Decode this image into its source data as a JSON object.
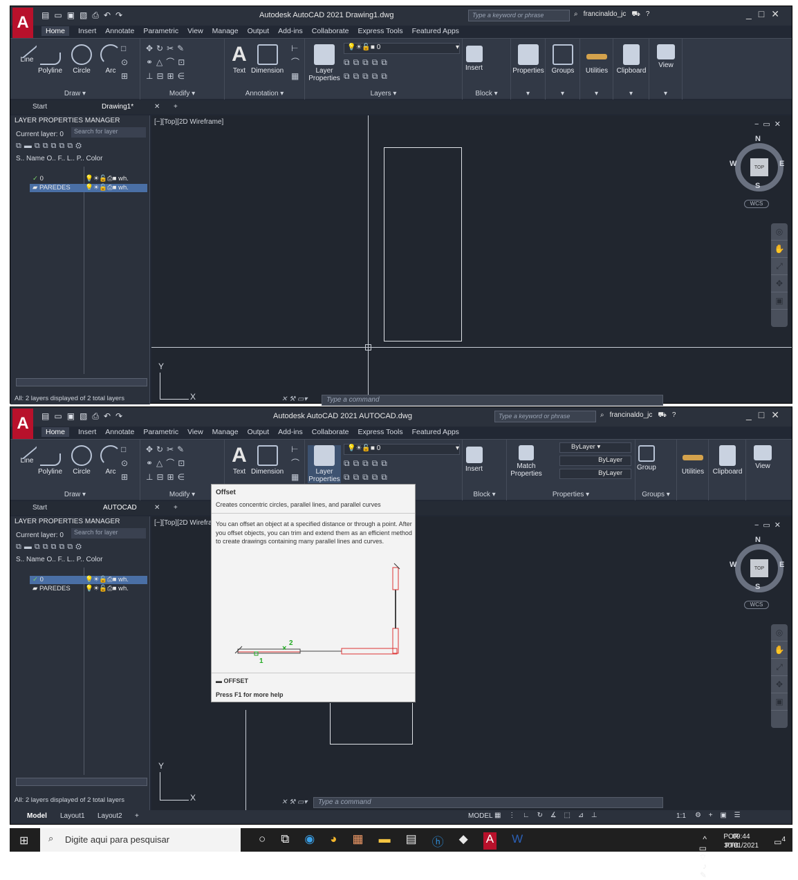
{
  "top_window": {
    "app_title": "Autodesk AutoCAD 2021  Drawing1.dwg",
    "search_placeholder": "Type a keyword or phrase",
    "user": "francinaldo_jc",
    "ribbon_tabs": [
      "Home",
      "Insert",
      "Annotate",
      "Parametric",
      "View",
      "Manage",
      "Output",
      "Add-ins",
      "Collaborate",
      "Express Tools",
      "Featured Apps"
    ],
    "draw_buttons": [
      "Line",
      "Polyline",
      "Circle",
      "Arc"
    ],
    "groups": {
      "draw": "Draw ▾",
      "modify": "Modify ▾",
      "annotation": "Annotation ▾",
      "layers": "Layers ▾",
      "block": "Block ▾"
    },
    "text_btn": "Text",
    "dimension_btn": "Dimension",
    "layer_properties": "Layer Properties",
    "layer_current": "0",
    "insert_btn": "Insert",
    "properties_btn": "Properties",
    "groups_btn": "Groups",
    "utilities_btn": "Utilities",
    "clipboard_btn": "Clipboard",
    "view_btn": "View",
    "doc_tabs": [
      "Start",
      "Drawing1*"
    ],
    "viewport_label": "[−][Top][2D Wireframe]",
    "panel_title": "LAYER PROPERTIES MANAGER",
    "current_layer": "Current layer: 0",
    "layer_search": "Search for layer",
    "col_headers": "S..  Name      O.. F.. L.. P.. Color",
    "layers": [
      {
        "name": "0",
        "color": "wh."
      },
      {
        "name": "PAREDES",
        "color": "wh."
      }
    ],
    "layers_status": "All: 2 layers displayed of 2 total layers",
    "command_placeholder": "Type a command",
    "wcs": "WCS"
  },
  "bottom_window": {
    "app_title": "Autodesk AutoCAD 2021   AUTOCAD.dwg",
    "search_placeholder": "Type a keyword or phrase",
    "user": "francinaldo_jc",
    "ribbon_tabs": [
      "Home",
      "Insert",
      "Annotate",
      "Parametric",
      "View",
      "Manage",
      "Output",
      "Add-ins",
      "Collaborate",
      "Express Tools",
      "Featured Apps"
    ],
    "draw_buttons": [
      "Line",
      "Polyline",
      "Circle",
      "Arc"
    ],
    "groups": {
      "draw": "Draw ▾",
      "modify": "Modify ▾",
      "block": "Block ▾",
      "properties": "Properties ▾",
      "groups": "Groups ▾"
    },
    "text_btn": "Text",
    "dimension_btn": "Dimension",
    "layer_properties": "Layer Properties",
    "layer_current": "0",
    "insert_btn": "Insert",
    "match_properties": "Match Properties",
    "bylayer": [
      "ByLayer",
      "ByLayer",
      "ByLayer"
    ],
    "group_btn": "Group",
    "utilities_btn": "Utilities",
    "clipboard_btn": "Clipboard",
    "view_btn": "View",
    "doc_tabs": [
      "Start",
      "AUTOCAD"
    ],
    "viewport_label": "[−][Top][2D Wirefra",
    "panel_title": "LAYER PROPERTIES MANAGER",
    "current_layer": "Current layer: 0",
    "layer_search": "Search for layer",
    "col_headers": "S..  Name      O.. F.. L.. P.. Color",
    "layers": [
      {
        "name": "0",
        "color": "wh."
      },
      {
        "name": "PAREDES",
        "color": "wh."
      }
    ],
    "layers_status": "All: 2 layers displayed of 2 total layers",
    "command_placeholder": "Type a command",
    "wcs": "WCS",
    "layout_tabs": [
      "Model",
      "Layout1",
      "Layout2"
    ],
    "model_label": "MODEL",
    "scale": "1:1"
  },
  "tooltip": {
    "title": "Offset",
    "summary": "Creates concentric circles, parallel lines, and parallel curves",
    "description": "You can offset an object at a specified distance or through a point. After you offset objects, you can trim and extend them as an efficient method to create drawings containing many parallel lines and curves.",
    "command": "OFFSET",
    "help": "Press F1 for more help",
    "point_labels": [
      "1",
      "2"
    ]
  },
  "taskbar": {
    "search": "Digite aqui para pesquisar",
    "lang": "POR",
    "lang2": "PTB",
    "time": "09:44",
    "date": "30/01/2021",
    "notif_count": "4"
  },
  "colors": {
    "bg": "#222834",
    "ribbon": "#323946",
    "accent": "#b8112b",
    "selected_layer": "#4a6fa5"
  }
}
